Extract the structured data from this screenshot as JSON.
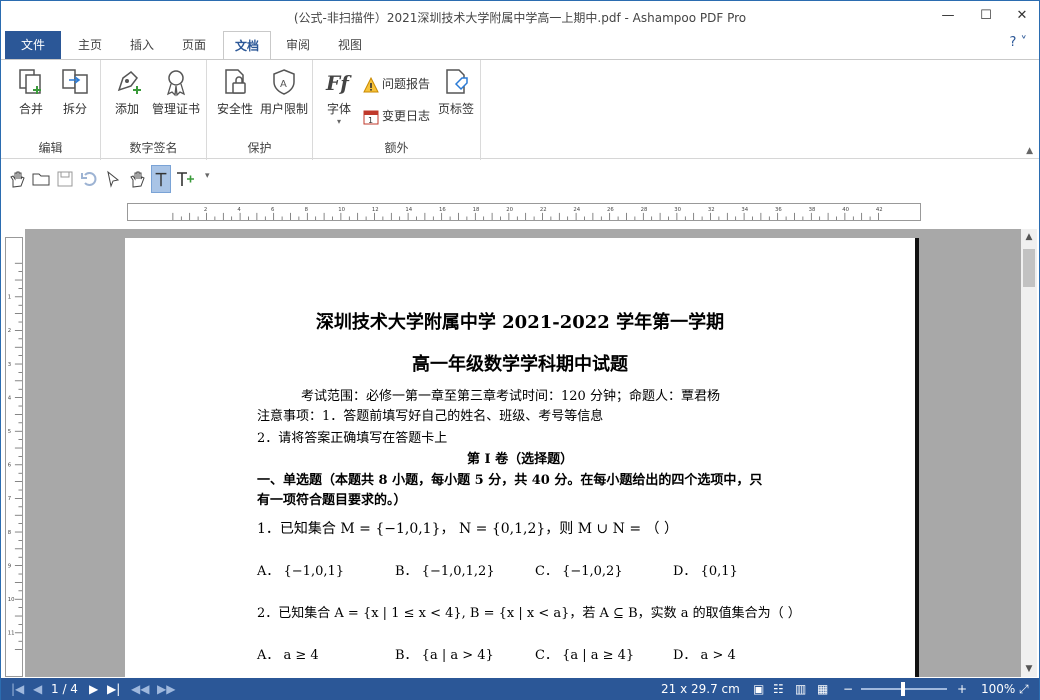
{
  "window": {
    "title": "(公式-非扫描件）2021深圳技术大学附属中学高一上期中.pdf - Ashampoo PDF Pro",
    "min_label": "—",
    "max_label": "☐",
    "close_label": "✕"
  },
  "tabs": [
    {
      "label": "文件"
    },
    {
      "label": "主页"
    },
    {
      "label": "插入"
    },
    {
      "label": "页面"
    },
    {
      "label": "文档"
    },
    {
      "label": "审阅"
    },
    {
      "label": "视图"
    }
  ],
  "help_label": "? ˅",
  "ribbon": {
    "groups": [
      {
        "label": "编辑",
        "buttons": [
          "合并",
          "拆分"
        ]
      },
      {
        "label": "数字签名",
        "buttons": [
          "添加",
          "管理证书"
        ]
      },
      {
        "label": "保护",
        "buttons": [
          "安全性",
          "用户限制"
        ]
      },
      {
        "label": "额外",
        "buttons": [
          "字体",
          "问题报告",
          "变更日志",
          "页标签"
        ]
      }
    ]
  },
  "document": {
    "title1": "深圳技术大学附属中学 2021-2022 学年第一学期",
    "title2": "高一年级数学学科期中试题",
    "lines": [
      "考试范围：必修一第一章至第三章考试时间：120 分钟；命题人：覃君杨",
      "注意事项：1．答题前填写好自己的姓名、班级、考号等信息",
      "2．请将答案正确填写在答题卡上",
      "第 I 卷（选择题）",
      "一、单选题（本题共 8 小题，每小题 5 分，共 40 分。在每小题给出的四个选项中，只",
      "有一项符合题目要求的。）",
      "1．已知集合 M = {−1,0,1}，  N = {0,1,2}，则 M ∪ N = （   ）",
      "2．已知集合 A = {x | 1 ≤ x < 4}, B = {x | x < a}，若 A ⊆ B，实数 a 的取值集合为（      ）"
    ],
    "q1_options": [
      "A．  {−1,0,1}",
      "B．  {−1,0,1,2}",
      "C．  {−1,0,2}",
      "D．  {0,1}"
    ],
    "q2_options": [
      "A．  a ≥ 4",
      "B．  {a | a > 4}",
      "C．  {a | a ≥ 4}",
      "D．  a > 4"
    ]
  },
  "status": {
    "page": "1 / 4",
    "size": "21 x 29.7 cm",
    "zoom": "100%"
  },
  "colors": {
    "accent": "#2b5797"
  }
}
